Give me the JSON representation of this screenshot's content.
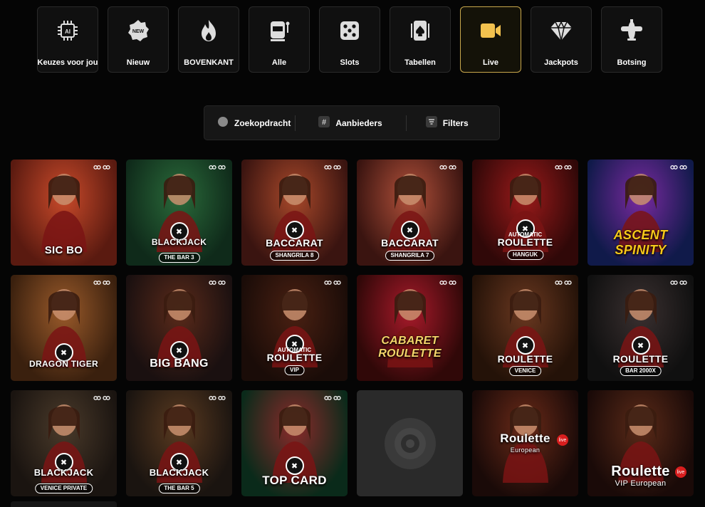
{
  "categories": [
    {
      "label": "Keuzes voor jou",
      "icon": "ai-chip-icon"
    },
    {
      "label": "Nieuw",
      "icon": "new-badge-icon"
    },
    {
      "label": "BOVENKANT",
      "icon": "flame-icon"
    },
    {
      "label": "Alle",
      "icon": "slot-machine-icon"
    },
    {
      "label": "Slots",
      "icon": "dice-icon"
    },
    {
      "label": "Tabellen",
      "icon": "playing-card-icon"
    },
    {
      "label": "Live",
      "icon": "video-camera-icon",
      "active": true
    },
    {
      "label": "Jackpots",
      "icon": "diamond-icon"
    },
    {
      "label": "Botsing",
      "icon": "airplane-icon"
    }
  ],
  "toolbar": {
    "search_label": "Zoekopdracht",
    "providers_label": "Aanbieders",
    "filters_label": "Filters"
  },
  "games": [
    {
      "title": "SIC BO",
      "subtitle": "",
      "top": "",
      "bg": [
        "#5a1a10",
        "#c94a2a"
      ]
    },
    {
      "title": "BLACKJACK",
      "subtitle": "THE BAR 3",
      "top": "",
      "bg": [
        "#0f2a1a",
        "#2a6a3a"
      ]
    },
    {
      "title": "BACCARAT",
      "subtitle": "SHANGRILA 8",
      "top": "",
      "bg": [
        "#3a1410",
        "#a8482a"
      ]
    },
    {
      "title": "BACCARAT",
      "subtitle": "SHANGRILA 7",
      "top": "",
      "bg": [
        "#3a1410",
        "#b0503a"
      ]
    },
    {
      "title": "ROULETTE",
      "subtitle": "HANGUK",
      "top": "AUTOMATIC",
      "bg": [
        "#300808",
        "#9a1a1a"
      ]
    },
    {
      "title": "ASCENT SPINITY",
      "subtitle": "",
      "top": "",
      "bg": [
        "#101a4a",
        "#7a2aa0"
      ]
    },
    {
      "title": "DRAGON TIGER",
      "subtitle": "",
      "top": "",
      "bg": [
        "#3a200e",
        "#9a5a2a"
      ]
    },
    {
      "title": "BIG BANG",
      "subtitle": "",
      "top": "",
      "bg": [
        "#1a1010",
        "#5a2a1a"
      ]
    },
    {
      "title": "ROULETTE",
      "subtitle": "VIP",
      "top": "AUTOMATIC",
      "bg": [
        "#1a0c08",
        "#4a2012"
      ]
    },
    {
      "title": "CABARET ROULETTE",
      "subtitle": "",
      "top": "",
      "bg": [
        "#300808",
        "#a81a2a"
      ]
    },
    {
      "title": "ROULETTE",
      "subtitle": "VENICE",
      "top": "",
      "bg": [
        "#241208",
        "#6a3820"
      ]
    },
    {
      "title": "ROULETTE",
      "subtitle": "BAR 2000X",
      "top": "",
      "bg": [
        "#101010",
        "#3a3030"
      ]
    },
    {
      "title": "BLACKJACK",
      "subtitle": "VENICE PRIVATE",
      "top": "",
      "bg": [
        "#1a1410",
        "#4a3a2a"
      ]
    },
    {
      "title": "BLACKJACK",
      "subtitle": "THE BAR 5",
      "top": "",
      "bg": [
        "#1a1410",
        "#5a3a20"
      ]
    },
    {
      "title": "TOP CARD",
      "subtitle": "",
      "top": "",
      "bg": [
        "#0a2a1a",
        "#8a2a2a"
      ]
    },
    {
      "title": "",
      "subtitle": "",
      "top": "",
      "bg": [
        "#2a2a2a",
        "#2e2e2e"
      ],
      "placeholder": true
    },
    {
      "title": "Roulette",
      "subtitle": "European",
      "top": "",
      "bg": [
        "#1a0a08",
        "#6a2a18"
      ],
      "live": true
    },
    {
      "title": "Roulette",
      "subtitle": "VIP European",
      "top": "",
      "bg": [
        "#1a0a08",
        "#5a2a18"
      ],
      "live": true
    }
  ],
  "colors": {
    "accent": "#c9a84c",
    "icon_gold": "#f2c14e",
    "background": "#050505"
  }
}
